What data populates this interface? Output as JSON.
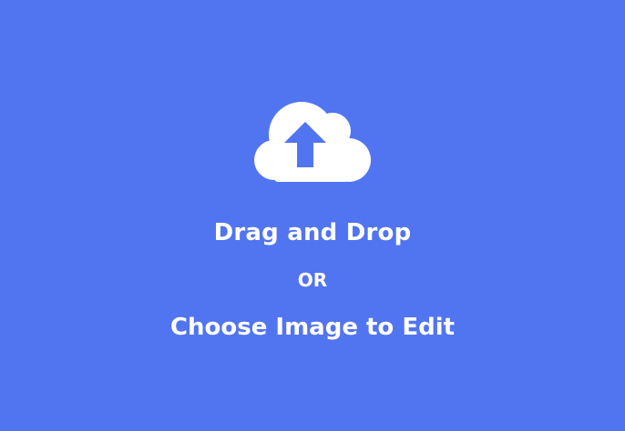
{
  "upload": {
    "icon": "cloud-upload-icon",
    "drag_text": "Drag and Drop",
    "or_text": "OR",
    "choose_text": "Choose Image to Edit"
  },
  "colors": {
    "background": "#5174F0",
    "foreground": "#FFFFFF",
    "arrow": "#5174F0"
  }
}
